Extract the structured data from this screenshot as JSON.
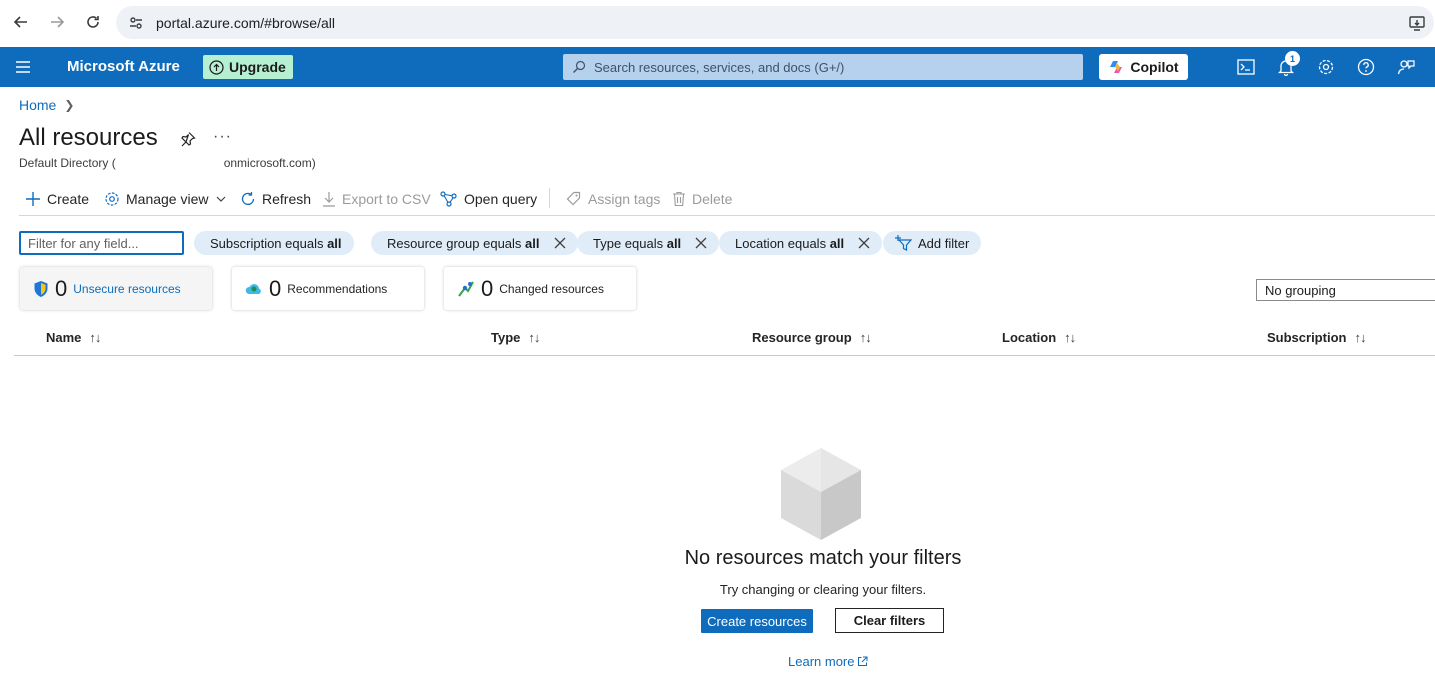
{
  "browser": {
    "url": "portal.azure.com/#browse/all"
  },
  "header": {
    "brand": "Microsoft Azure",
    "upgrade_label": "Upgrade",
    "search_placeholder": "Search resources, services, and docs (G+/)",
    "copilot_label": "Copilot",
    "notification_count": "1",
    "colors": {
      "bar": "#0f6cbd",
      "upgrade": "#b6f0d2"
    }
  },
  "breadcrumb": {
    "home": "Home"
  },
  "page": {
    "title": "All resources",
    "subtitle_prefix": "Default Directory (",
    "subtitle_suffix": "onmicrosoft.com)",
    "more": "···"
  },
  "toolbar": {
    "create": "Create",
    "manage_view": "Manage view",
    "refresh": "Refresh",
    "export_csv": "Export to CSV",
    "open_query": "Open query",
    "assign_tags": "Assign tags",
    "delete": "Delete"
  },
  "filters": {
    "placeholder": "Filter for any field...",
    "pills": [
      {
        "text": "Subscription equals ",
        "value": "all"
      },
      {
        "text": "Resource group equals ",
        "value": "all"
      },
      {
        "text": "Type equals ",
        "value": "all"
      },
      {
        "text": "Location equals ",
        "value": "all"
      }
    ],
    "add_filter": "Add filter"
  },
  "summary": [
    {
      "count": "0",
      "label": "Unsecure resources"
    },
    {
      "count": "0",
      "label": "Recommendations"
    },
    {
      "count": "0",
      "label": "Changed resources"
    }
  ],
  "grouping": {
    "selected": "No grouping"
  },
  "table": {
    "columns": [
      "Name",
      "Type",
      "Resource group",
      "Location",
      "Subscription"
    ]
  },
  "empty_state": {
    "title": "No resources match your filters",
    "description": "Try changing or clearing your filters.",
    "create_button": "Create resources",
    "clear_button": "Clear filters",
    "learn_more": "Learn more"
  }
}
